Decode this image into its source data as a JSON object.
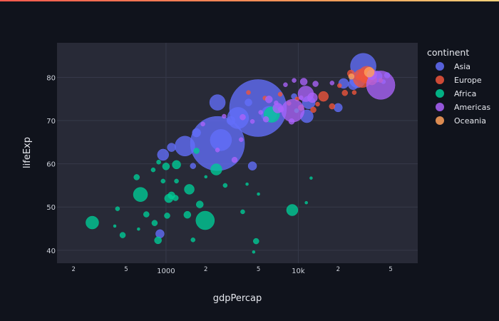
{
  "chart_data": {
    "type": "scatter",
    "xlabel": "gdpPercap",
    "ylabel": "lifeExp",
    "x_scale": "log",
    "xlim": [
      150,
      80000
    ],
    "ylim": [
      37,
      88
    ],
    "x_tick_labels": [
      {
        "value": 200,
        "label": "2",
        "minor": true
      },
      {
        "value": 500,
        "label": "5",
        "minor": true
      },
      {
        "value": 1000,
        "label": "1000",
        "minor": false
      },
      {
        "value": 2000,
        "label": "2",
        "minor": true
      },
      {
        "value": 5000,
        "label": "5",
        "minor": true
      },
      {
        "value": 10000,
        "label": "10k",
        "minor": false
      },
      {
        "value": 20000,
        "label": "2",
        "minor": true
      },
      {
        "value": 50000,
        "label": "5",
        "minor": true
      }
    ],
    "y_ticks": [
      40,
      50,
      60,
      70,
      80
    ],
    "grid": true,
    "legend": {
      "title": "continent",
      "placement": "right"
    },
    "marker_size_note": "bubble area encodes population",
    "series": [
      {
        "name": "Asia",
        "color": "#636efa",
        "points": [
          [
            31000,
            82.6,
            18
          ],
          [
            28000,
            79.4,
            11
          ],
          [
            39000,
            80.2,
            8
          ],
          [
            22000,
            78.6,
            7
          ],
          [
            12000,
            74.2,
            9
          ],
          [
            6000,
            71.5,
            11
          ],
          [
            4960,
            72.9,
            40
          ],
          [
            2450,
            64.7,
            38
          ],
          [
            3500,
            70.6,
            15
          ],
          [
            2600,
            65.5,
            15
          ],
          [
            1390,
            64.1,
            14
          ],
          [
            1100,
            63.8,
            6
          ],
          [
            950,
            62.1,
            8
          ],
          [
            2450,
            74.2,
            11
          ],
          [
            1600,
            59.5,
            4
          ],
          [
            1700,
            67.2,
            6
          ],
          [
            4500,
            59.5,
            6
          ],
          [
            900,
            43.8,
            6
          ],
          [
            11600,
            71.0,
            9
          ],
          [
            20000,
            73.0,
            6
          ],
          [
            26000,
            78.3,
            7
          ],
          [
            47000,
            80.5,
            4
          ],
          [
            44000,
            79.0,
            3
          ],
          [
            7000,
            72.8,
            6
          ],
          [
            3100,
            70.0,
            6
          ],
          [
            4200,
            74.2,
            5
          ],
          [
            9300,
            75.6,
            4
          ]
        ]
      },
      {
        "name": "Europe",
        "color": "#ef553b",
        "points": [
          [
            33000,
            80.6,
            12
          ],
          [
            30500,
            79.8,
            13
          ],
          [
            34500,
            80.5,
            8
          ],
          [
            36000,
            79.4,
            7
          ],
          [
            15500,
            75.6,
            7
          ],
          [
            18000,
            73.3,
            4
          ],
          [
            22500,
            76.4,
            4
          ],
          [
            25000,
            80.9,
            5
          ],
          [
            28500,
            80.0,
            4
          ],
          [
            32000,
            79.8,
            4
          ],
          [
            10500,
            73.0,
            4
          ],
          [
            13000,
            72.5,
            4
          ],
          [
            8500,
            74.0,
            3
          ],
          [
            14000,
            73.8,
            3
          ],
          [
            20500,
            78.1,
            3
          ],
          [
            9800,
            75.0,
            3
          ],
          [
            36500,
            81.2,
            4
          ],
          [
            42000,
            79.3,
            3
          ],
          [
            26500,
            76.5,
            3
          ],
          [
            5600,
            75.2,
            3
          ],
          [
            7300,
            76.1,
            3
          ],
          [
            4200,
            76.5,
            3
          ]
        ]
      },
      {
        "name": "Africa",
        "color": "#00cc96",
        "points": [
          [
            277,
            46.4,
            9
          ],
          [
            641,
            52.9,
            10
          ],
          [
            1977,
            46.9,
            13
          ],
          [
            1500,
            54.1,
            7
          ],
          [
            2400,
            58.7,
            8
          ],
          [
            1050,
            52.0,
            6
          ],
          [
            1200,
            59.8,
            6
          ],
          [
            1000,
            59.4,
            5
          ],
          [
            1100,
            52.7,
            5
          ],
          [
            6300,
            71.4,
            11
          ],
          [
            9000,
            49.3,
            8
          ],
          [
            1450,
            48.2,
            5
          ],
          [
            1800,
            50.6,
            5
          ],
          [
            710,
            48.3,
            4
          ],
          [
            870,
            42.3,
            5
          ],
          [
            470,
            43.5,
            4
          ],
          [
            600,
            56.9,
            4
          ],
          [
            820,
            46.3,
            4
          ],
          [
            1020,
            48.0,
            4
          ],
          [
            1180,
            52.1,
            4
          ],
          [
            1700,
            63.0,
            4
          ],
          [
            2800,
            55.0,
            3
          ],
          [
            4800,
            42.1,
            4
          ],
          [
            3800,
            48.9,
            3
          ],
          [
            12500,
            56.7,
            2
          ],
          [
            430,
            49.6,
            3
          ],
          [
            880,
            60.4,
            3
          ],
          [
            410,
            45.6,
            2
          ],
          [
            1600,
            42.4,
            3
          ],
          [
            620,
            44.9,
            2
          ],
          [
            4100,
            55.3,
            2
          ],
          [
            5000,
            53.0,
            2
          ],
          [
            11500,
            51.0,
            2
          ],
          [
            4600,
            39.6,
            2
          ],
          [
            2000,
            57.0,
            2
          ],
          [
            9700,
            72.3,
            3
          ],
          [
            800,
            58.6,
            3
          ],
          [
            1200,
            56.0,
            3
          ],
          [
            950,
            56.0,
            3
          ]
        ]
      },
      {
        "name": "Americas",
        "color": "#ab63fa",
        "points": [
          [
            42000,
            78.2,
            20
          ],
          [
            36000,
            80.6,
            7
          ],
          [
            11400,
            76.2,
            11
          ],
          [
            9100,
            72.3,
            16
          ],
          [
            12800,
            75.3,
            7
          ],
          [
            7000,
            72.9,
            7
          ],
          [
            11000,
            79.0,
            5
          ],
          [
            13500,
            78.5,
            4
          ],
          [
            6000,
            74.9,
            5
          ],
          [
            8900,
            69.8,
            4
          ],
          [
            5700,
            70.3,
            4
          ],
          [
            3800,
            70.8,
            4
          ],
          [
            3300,
            60.9,
            4
          ],
          [
            5200,
            71.9,
            3
          ],
          [
            2750,
            71.0,
            3
          ],
          [
            1900,
            69.2,
            3
          ],
          [
            2450,
            63.2,
            3
          ],
          [
            9300,
            79.3,
            3
          ],
          [
            6800,
            74.1,
            3
          ],
          [
            8000,
            78.3,
            3
          ],
          [
            18000,
            78.7,
            3
          ],
          [
            4500,
            69.8,
            3
          ],
          [
            7400,
            72.6,
            4
          ],
          [
            10500,
            75.3,
            3
          ],
          [
            3700,
            65.6,
            3
          ]
        ]
      },
      {
        "name": "Oceania",
        "color": "#ffa15a",
        "points": [
          [
            34400,
            81.2,
            7
          ],
          [
            25200,
            80.2,
            4
          ]
        ]
      }
    ]
  }
}
